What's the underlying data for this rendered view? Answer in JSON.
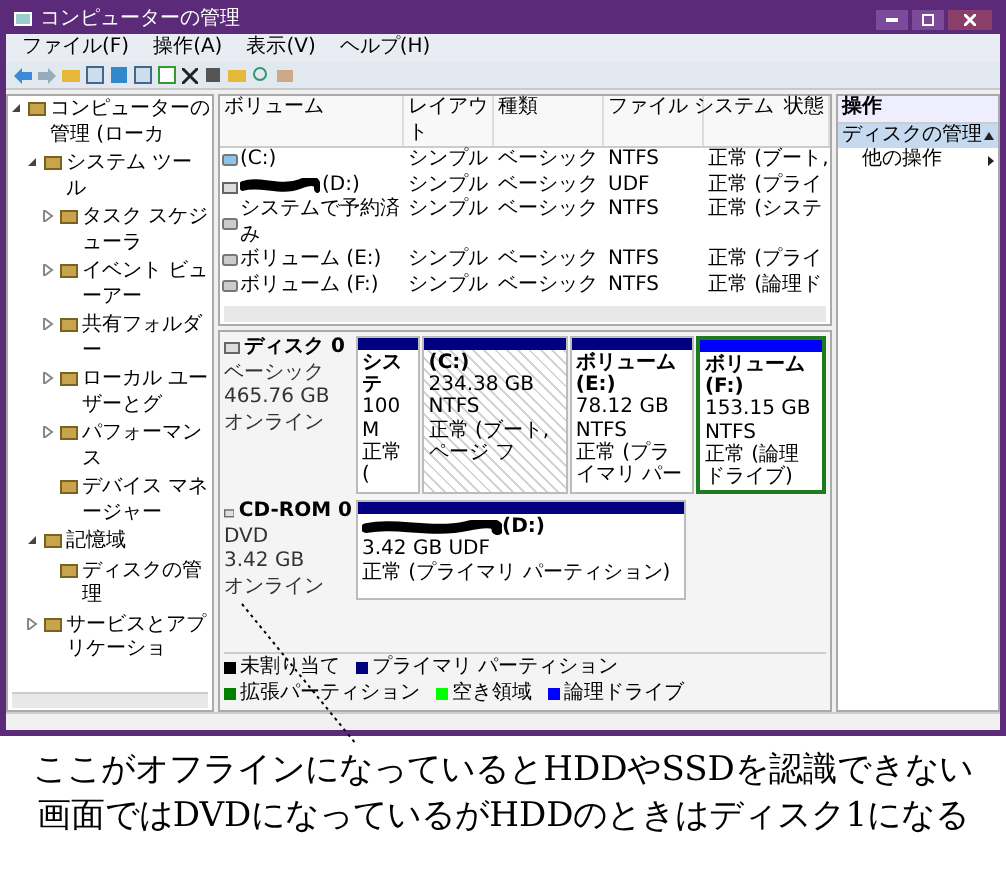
{
  "window": {
    "title": "コンピューターの管理"
  },
  "menu": [
    "ファイル(F)",
    "操作(A)",
    "表示(V)",
    "ヘルプ(H)"
  ],
  "tree": [
    {
      "label": "コンピューターの管理 (ローカ",
      "expanded": true,
      "children": [
        {
          "label": "システム ツール",
          "expanded": true,
          "children": [
            {
              "label": "タスク スケジューラ",
              "expanded": false
            },
            {
              "label": "イベント ビューアー",
              "expanded": false
            },
            {
              "label": "共有フォルダー",
              "expanded": false
            },
            {
              "label": "ローカル ユーザーとグ",
              "expanded": false
            },
            {
              "label": "パフォーマンス",
              "expanded": false
            },
            {
              "label": "デバイス マネージャー"
            }
          ]
        },
        {
          "label": "記憶域",
          "expanded": true,
          "children": [
            {
              "label": "ディスクの管理"
            }
          ]
        },
        {
          "label": "サービスとアプリケーショ",
          "expanded": false
        }
      ]
    }
  ],
  "table": {
    "columns": [
      "ボリューム",
      "レイアウト",
      "種類",
      "ファイル システム",
      "状態"
    ],
    "rows": [
      {
        "kind": "volume",
        "redacted": false,
        "cells": [
          "(C:)",
          "シンプル",
          "ベーシック",
          "NTFS",
          "正常 (ブート,"
        ]
      },
      {
        "kind": "disc",
        "redacted": true,
        "cells": [
          "(D:)",
          "シンプル",
          "ベーシック",
          "UDF",
          "正常 (プライ"
        ]
      },
      {
        "kind": "volume",
        "redacted": false,
        "cells": [
          "システムで予約済み",
          "シンプル",
          "ベーシック",
          "NTFS",
          "正常 (システ"
        ]
      },
      {
        "kind": "volume",
        "redacted": false,
        "cells": [
          "ボリューム (E:)",
          "シンプル",
          "ベーシック",
          "NTFS",
          "正常 (プライ"
        ]
      },
      {
        "kind": "volume",
        "redacted": false,
        "cells": [
          "ボリューム (F:)",
          "シンプル",
          "ベーシック",
          "NTFS",
          "正常 (論理ド"
        ]
      }
    ]
  },
  "disks": [
    {
      "kind": "disk",
      "name": "ディスク 0",
      "lines": [
        "ベーシック",
        "465.76 GB",
        "オンライン"
      ],
      "partitions": [
        {
          "color": "#000080",
          "selected": false,
          "in_extended": false,
          "redacted": false,
          "lines": [
            "システ",
            "100 M",
            "正常 ("
          ]
        },
        {
          "color": "#000080",
          "selected": true,
          "in_extended": false,
          "redacted": false,
          "lines": [
            "(C:)",
            "234.38 GB NTFS",
            "正常 (ブート, ページ フ"
          ]
        },
        {
          "color": "#000080",
          "selected": false,
          "in_extended": false,
          "redacted": false,
          "lines": [
            "ボリューム (E:)",
            "78.12 GB NTFS",
            "正常 (プライマリ パー"
          ]
        },
        {
          "color": "#0000ff",
          "selected": false,
          "in_extended": true,
          "redacted": false,
          "lines": [
            "ボリューム (F:)",
            "153.15 GB NTFS",
            "正常 (論理ドライブ)"
          ]
        }
      ]
    },
    {
      "kind": "cdrom",
      "name": "CD-ROM 0",
      "lines": [
        "DVD",
        "3.42 GB",
        "オンライン"
      ],
      "partitions": [
        {
          "color": "#000080",
          "selected": false,
          "in_extended": false,
          "redacted": true,
          "lines": [
            "(D:)",
            "3.42 GB UDF",
            "正常 (プライマリ パーティション)"
          ]
        }
      ]
    }
  ],
  "legend": [
    {
      "label": "未割り当て",
      "color": "#000000"
    },
    {
      "label": "プライマリ パーティション",
      "color": "#000080"
    },
    {
      "label": "拡張パーティション",
      "color": "#008000"
    },
    {
      "label": "空き領域",
      "color": "#00ff00"
    },
    {
      "label": "論理ドライブ",
      "color": "#0000ff"
    }
  ],
  "actions": {
    "header": "操作",
    "section": {
      "label": "ディスクの管理",
      "expanded": true
    },
    "items": [
      "他の操作"
    ]
  },
  "annotation": [
    "ここがオフラインになっているとHDDやSSDを認識できない",
    "画面ではDVDになっているがHDDのときはディスク1になる"
  ]
}
